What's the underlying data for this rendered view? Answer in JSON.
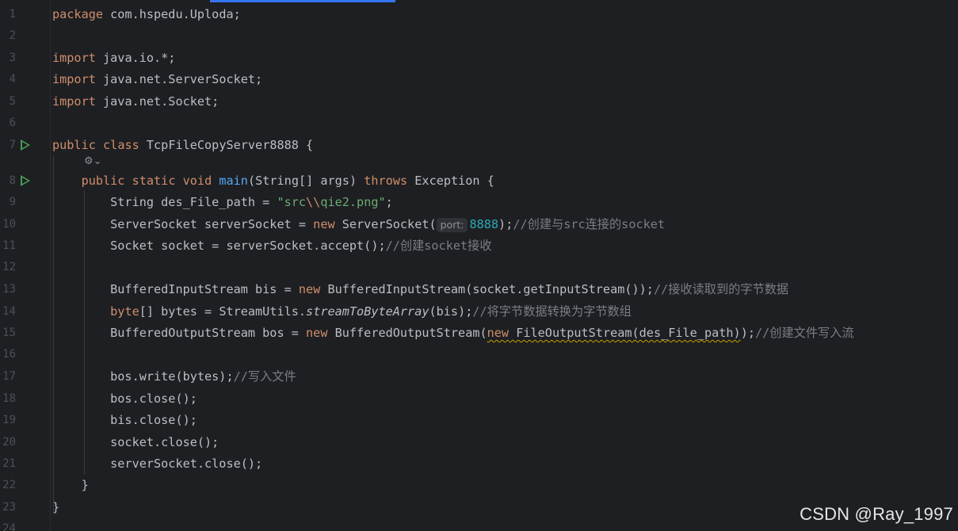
{
  "editor": {
    "lines": [
      {
        "num": "1",
        "segments": [
          {
            "t": "package",
            "c": "kw"
          },
          {
            "t": " com.hspedu.Uploda;"
          }
        ]
      },
      {
        "num": "2",
        "segments": []
      },
      {
        "num": "3",
        "segments": [
          {
            "t": "import",
            "c": "kw"
          },
          {
            "t": " java.io.*;"
          }
        ]
      },
      {
        "num": "4",
        "segments": [
          {
            "t": "import",
            "c": "kw"
          },
          {
            "t": " java.net.ServerSocket;"
          }
        ]
      },
      {
        "num": "5",
        "segments": [
          {
            "t": "import",
            "c": "kw"
          },
          {
            "t": " java.net.Socket;"
          }
        ]
      },
      {
        "num": "6",
        "segments": []
      },
      {
        "num": "7",
        "run": true,
        "segments": [
          {
            "t": "public",
            "c": "kw"
          },
          {
            "t": " "
          },
          {
            "t": "class",
            "c": "kw"
          },
          {
            "t": " TcpFileCopyServer8888 {"
          }
        ]
      },
      {
        "num": "8",
        "run": true,
        "segments": [
          {
            "t": "    "
          },
          {
            "t": "public",
            "c": "kw"
          },
          {
            "t": " "
          },
          {
            "t": "static",
            "c": "kw"
          },
          {
            "t": " "
          },
          {
            "t": "void",
            "c": "kw"
          },
          {
            "t": " "
          },
          {
            "t": "main",
            "c": "fn"
          },
          {
            "t": "(String[] args) "
          },
          {
            "t": "throws",
            "c": "kw"
          },
          {
            "t": " Exception {"
          }
        ]
      },
      {
        "num": "9",
        "segments": [
          {
            "t": "        String des_File_path = "
          },
          {
            "t": "\"src",
            "c": "str"
          },
          {
            "t": "\\\\",
            "c": "esc"
          },
          {
            "t": "qie2.png\"",
            "c": "str"
          },
          {
            "t": ";"
          }
        ]
      },
      {
        "num": "10",
        "segments": [
          {
            "t": "        ServerSocket serverSocket = "
          },
          {
            "t": "new",
            "c": "kw"
          },
          {
            "t": " ServerSocket("
          },
          {
            "t": "port:",
            "c": "hint"
          },
          {
            "t": "8888",
            "c": "num"
          },
          {
            "t": ");"
          },
          {
            "t": "//创建与src连接的socket",
            "c": "cm"
          }
        ]
      },
      {
        "num": "11",
        "segments": [
          {
            "t": "        Socket socket = serverSocket.accept();"
          },
          {
            "t": "//创建socket接收",
            "c": "cm"
          }
        ]
      },
      {
        "num": "12",
        "segments": []
      },
      {
        "num": "13",
        "segments": [
          {
            "t": "        BufferedInputStream bis = "
          },
          {
            "t": "new",
            "c": "kw"
          },
          {
            "t": " BufferedInputStream(socket.getInputStream());"
          },
          {
            "t": "//接收读取到的字节数据",
            "c": "cm"
          }
        ]
      },
      {
        "num": "14",
        "segments": [
          {
            "t": "        "
          },
          {
            "t": "byte",
            "c": "kw"
          },
          {
            "t": "[] bytes = StreamUtils."
          },
          {
            "t": "streamToByteArray",
            "c": "it"
          },
          {
            "t": "(bis);"
          },
          {
            "t": "//将字节数据转换为字节数组",
            "c": "cm"
          }
        ]
      },
      {
        "num": "15",
        "segments": [
          {
            "t": "        BufferedOutputStream bos = "
          },
          {
            "t": "new",
            "c": "kw"
          },
          {
            "t": " BufferedOutputStream("
          },
          {
            "t": "new",
            "c": "kw warn"
          },
          {
            "t": " FileOutputStream(des_File_path)",
            "c": "warn"
          },
          {
            "t": ");"
          },
          {
            "t": "//创建文件写入流",
            "c": "cm"
          }
        ]
      },
      {
        "num": "16",
        "segments": []
      },
      {
        "num": "17",
        "segments": [
          {
            "t": "        bos.write(bytes);"
          },
          {
            "t": "//写入文件",
            "c": "cm"
          }
        ]
      },
      {
        "num": "18",
        "segments": [
          {
            "t": "        bos.close();"
          }
        ]
      },
      {
        "num": "19",
        "segments": [
          {
            "t": "        bis.close();"
          }
        ]
      },
      {
        "num": "20",
        "segments": [
          {
            "t": "        socket.close();"
          }
        ]
      },
      {
        "num": "21",
        "segments": [
          {
            "t": "        serverSocket.close();"
          }
        ]
      },
      {
        "num": "22",
        "segments": [
          {
            "t": "    }"
          }
        ]
      },
      {
        "num": "23",
        "segments": [
          {
            "t": "}"
          }
        ]
      },
      {
        "num": "24",
        "segments": []
      }
    ],
    "inlay_icon": "ai-assistant-icon"
  },
  "watermark": "CSDN @Ray_1997",
  "colors": {
    "background": "#1e1f22",
    "keyword": "#cf8e6d",
    "string": "#6aab73",
    "number": "#2aacb8",
    "function": "#56a8f5",
    "comment": "#7a7e85",
    "text": "#bcbec4",
    "run_icon": "#499c54",
    "tab_accent": "#3574f0"
  }
}
